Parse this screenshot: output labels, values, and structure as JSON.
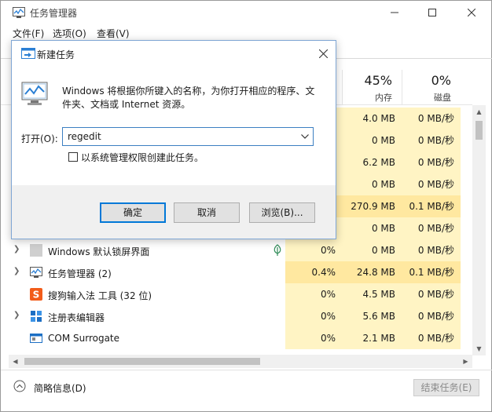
{
  "window": {
    "title": "任务管理器"
  },
  "menu": [
    "文件(F)",
    "选项(O)",
    "查看(V)"
  ],
  "columns": {
    "memory": {
      "pct": "45%",
      "name": "内存"
    },
    "disk": {
      "pct": "0%",
      "name": "磁盘"
    }
  },
  "rows": [
    {
      "name": "",
      "cpu": "",
      "mem": "4.0 MB",
      "disk": "0 MB/秒",
      "expander": false
    },
    {
      "name": "",
      "cpu": "",
      "mem": "0 MB",
      "disk": "0 MB/秒",
      "expander": false
    },
    {
      "name": "",
      "cpu": "",
      "mem": "6.2 MB",
      "disk": "0 MB/秒",
      "expander": false
    },
    {
      "name": "",
      "cpu": "",
      "mem": "0 MB",
      "disk": "0 MB/秒",
      "expander": false
    },
    {
      "name": "",
      "cpu": "",
      "mem": "270.9 MB",
      "disk": "0.1 MB/秒",
      "expander": false,
      "hot": true
    },
    {
      "name": "",
      "cpu": "",
      "mem": "0 MB",
      "disk": "0 MB/秒",
      "expander": false
    },
    {
      "name": "Windows 默认锁屏界面",
      "cpu": "0%",
      "mem": "0 MB",
      "disk": "0 MB/秒",
      "expander": true,
      "icon": "lockscreen-icon"
    },
    {
      "name": "任务管理器 (2)",
      "cpu": "0.4%",
      "mem": "24.8 MB",
      "disk": "0.1 MB/秒",
      "expander": true,
      "icon": "taskmgr-icon",
      "hot": true
    },
    {
      "name": "搜狗输入法 工具 (32 位)",
      "cpu": "0%",
      "mem": "4.5 MB",
      "disk": "0 MB/秒",
      "expander": false,
      "icon": "sogou-icon"
    },
    {
      "name": "注册表编辑器",
      "cpu": "0%",
      "mem": "5.6 MB",
      "disk": "0 MB/秒",
      "expander": true,
      "icon": "regedit-icon"
    },
    {
      "name": "COM Surrogate",
      "cpu": "0%",
      "mem": "2.1 MB",
      "disk": "0 MB/秒",
      "expander": false,
      "icon": "com-surrogate-icon"
    }
  ],
  "footer": {
    "brief": "简略信息(D)",
    "end_task": "结束任务(E)"
  },
  "dialog": {
    "title": "新建任务",
    "message": "Windows 将根据你所键入的名称，为你打开相应的程序、文件夹、文档或 Internet 资源。",
    "open_label": "打开(O):",
    "open_value": "regedit",
    "admin_label": "以系统管理权限创建此任务。",
    "ok": "确定",
    "cancel": "取消",
    "browse": "浏览(B)..."
  },
  "colors": {
    "heat_light": "#fff4c4",
    "heat_mid": "#ffe8a0",
    "accent": "#0078d7"
  }
}
